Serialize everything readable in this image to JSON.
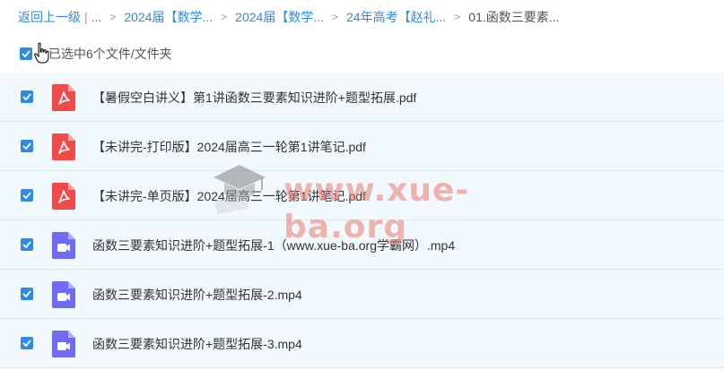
{
  "breadcrumb": {
    "back": "返回上一级",
    "ellipsis": "...",
    "items": [
      "2024届【数学...",
      "2024届【数学...",
      "24年高考【赵礼...",
      "01.函数三要素..."
    ]
  },
  "selection": {
    "label": "已选中6个文件/文件夹",
    "checked": true
  },
  "files": [
    {
      "name": "【暑假空白讲义】第1讲函数三要素知识进阶+题型拓展.pdf",
      "type": "pdf",
      "checked": true
    },
    {
      "name": "【未讲完-打印版】2024届高三一轮第1讲笔记.pdf",
      "type": "pdf",
      "checked": true
    },
    {
      "name": "【未讲完-单页版】2024届高三一轮第1讲笔记.pdf",
      "type": "pdf",
      "checked": true
    },
    {
      "name": "函数三要素知识进阶+题型拓展-1（www.xue-ba.org学霸网）.mp4",
      "type": "video",
      "checked": true
    },
    {
      "name": "函数三要素知识进阶+题型拓展-2.mp4",
      "type": "video",
      "checked": true
    },
    {
      "name": "函数三要素知识进阶+题型拓展-3.mp4",
      "type": "video",
      "checked": true
    }
  ],
  "watermark": {
    "text": "www.xue-ba.org",
    "icon": "graduation-cap-icon"
  },
  "colors": {
    "accent": "#2e8ae6",
    "pdf": "#f04b4b",
    "video": "#6f6bf2",
    "row_bg": "#f1f8fe"
  }
}
